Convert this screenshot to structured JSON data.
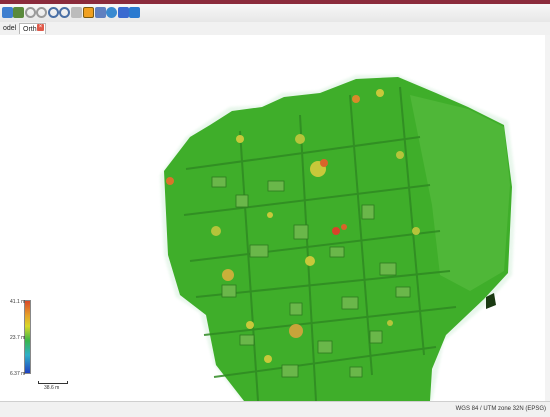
{
  "toolbar": {
    "buttons": [
      {
        "name": "open-project-icon",
        "color": "#3f7fcf"
      },
      {
        "name": "save-icon",
        "color": "#5a8a3c"
      },
      {
        "name": "undo-icon",
        "color": "#7a7a7a"
      },
      {
        "name": "redo-icon",
        "color": "#7a7a7a"
      },
      {
        "name": "zoom-in-icon",
        "color": "#4a6fa5"
      },
      {
        "name": "zoom-out-icon",
        "color": "#4a6fa5"
      },
      {
        "name": "measure-icon",
        "color": "#6a6a6a"
      },
      {
        "name": "image-overlay-icon",
        "color": "#f0a020"
      },
      {
        "name": "grid-icon",
        "color": "#6080c0"
      },
      {
        "name": "shape-icon",
        "color": "#3a8ad0"
      },
      {
        "name": "flag-icon",
        "color": "#3a6ad0"
      },
      {
        "name": "move-icon",
        "color": "#2a7ad0"
      }
    ]
  },
  "tabs": {
    "model_label": "odel",
    "ortho_label": "Ortho"
  },
  "legend": {
    "max": "41.1 m",
    "mid": "23.7 m",
    "min": "6.37 m"
  },
  "scale": {
    "label": "38.6 m"
  },
  "status": {
    "crs": "WGS 84 / UTM zone 32N (EPSG)"
  },
  "colors": {
    "terrain_base": "#3fae2a",
    "terrain_dark": "#2f8a22",
    "tree_high": "#d9642a",
    "tree_mid": "#c8c83a"
  }
}
